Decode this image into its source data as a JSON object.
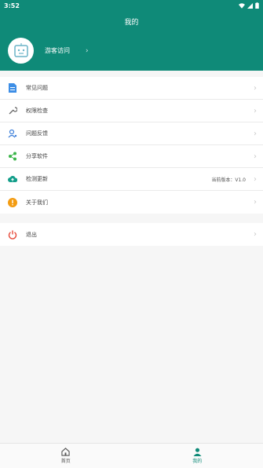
{
  "status_bar": {
    "time": "3:52"
  },
  "header": {
    "title": "我的"
  },
  "profile": {
    "name": "游客访问"
  },
  "menu": [
    {
      "label": "常见问题",
      "icon": "document-icon"
    },
    {
      "label": "权限检查",
      "icon": "wrench-icon"
    },
    {
      "label": "问题反馈",
      "icon": "feedback-user-icon"
    },
    {
      "label": "分享软件",
      "icon": "share-icon"
    },
    {
      "label": "检测更新",
      "icon": "cloud-upload-icon",
      "extra": "当前版本：V1.0"
    },
    {
      "label": "关于我们",
      "icon": "info-icon"
    }
  ],
  "logout": {
    "label": "退出",
    "icon": "power-icon"
  },
  "bottom_nav": [
    {
      "label": "首页",
      "icon": "home-icon"
    },
    {
      "label": "我的",
      "icon": "person-icon"
    }
  ],
  "colors": {
    "primary": "#0f8a78"
  }
}
